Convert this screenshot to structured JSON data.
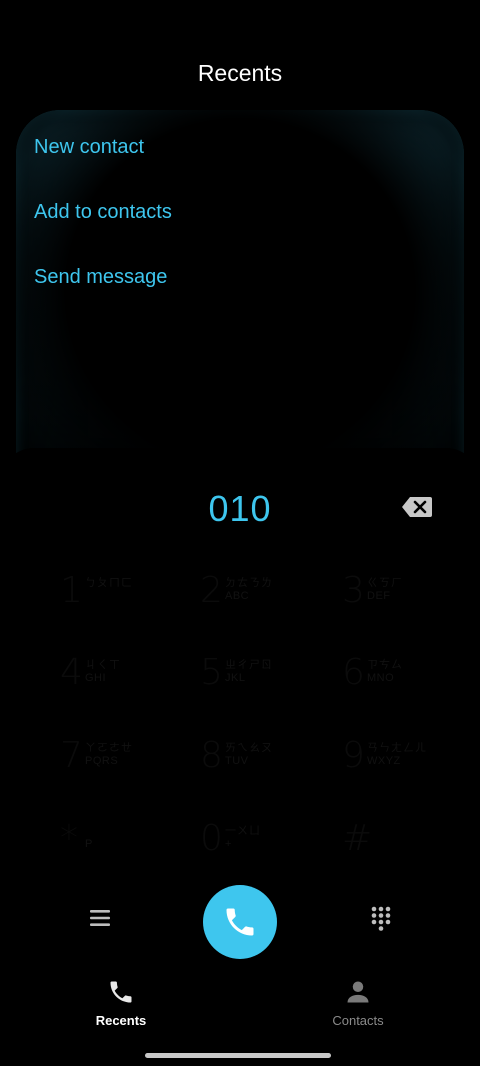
{
  "header": {
    "title": "Recents"
  },
  "menu": {
    "items": [
      {
        "label": "New contact"
      },
      {
        "label": "Add to contacts"
      },
      {
        "label": "Send message"
      }
    ]
  },
  "dialer": {
    "number": "010",
    "keys": [
      {
        "digit": "1",
        "sub1": "ㄅㄆㄇㄈ",
        "sub2": ""
      },
      {
        "digit": "2",
        "sub1": "ㄉㄊㄋㄌ",
        "sub2": "ABC"
      },
      {
        "digit": "3",
        "sub1": "ㄍㄎㄏ",
        "sub2": "DEF"
      },
      {
        "digit": "4",
        "sub1": "ㄐㄑㄒ",
        "sub2": "GHI"
      },
      {
        "digit": "5",
        "sub1": "ㄓㄔㄕㄖ",
        "sub2": "JKL"
      },
      {
        "digit": "6",
        "sub1": "ㄗㄘㄙ",
        "sub2": "MNO"
      },
      {
        "digit": "7",
        "sub1": "ㄚㄛㄜㄝ",
        "sub2": "PQRS"
      },
      {
        "digit": "8",
        "sub1": "ㄞㄟㄠㄡ",
        "sub2": "TUV"
      },
      {
        "digit": "9",
        "sub1": "ㄢㄣㄤㄥㄦ",
        "sub2": "WXYZ"
      },
      {
        "digit": "*",
        "sub1": "",
        "sub2": "P"
      },
      {
        "digit": "0",
        "sub1": "一ㄨㄩ",
        "sub2": "+"
      },
      {
        "digit": "#",
        "sub1": "",
        "sub2": ""
      }
    ]
  },
  "bottom_nav": {
    "recents_label": "Recents",
    "contacts_label": "Contacts"
  },
  "colors": {
    "accent": "#3ec6ee",
    "background": "#000000"
  }
}
